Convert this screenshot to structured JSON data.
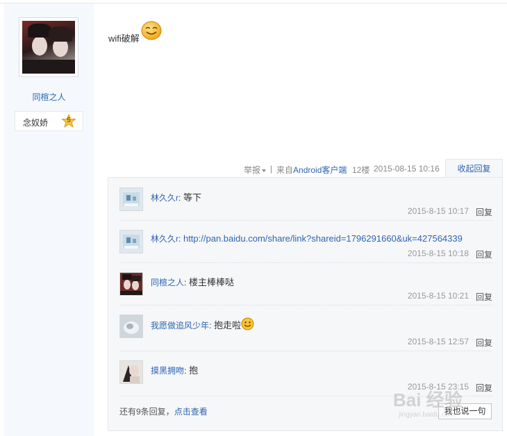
{
  "author": {
    "username": "同楦之人",
    "badge_name": "念奴娇",
    "badge_level": "5"
  },
  "post": {
    "text": "wifi破解",
    "emoticon": "smiley-face-icon"
  },
  "post_meta": {
    "report_label": "举报",
    "separator": "|",
    "from_prefix": "来自",
    "from_client": "Android客户端",
    "floor": "12楼",
    "date": "2015-08-15 10:16",
    "collapse_label": "收起回复"
  },
  "replies": [
    {
      "name": "林久久r",
      "content": "等下",
      "time": "2015-8-15 10:17",
      "reply_label": "回复"
    },
    {
      "name": "林久久r",
      "content": "http://pan.baidu.com/share/link?shareid=1796291660&uk=427564339",
      "time": "2015-8-15 10:18",
      "reply_label": "回复"
    },
    {
      "name": "同楦之人",
      "content": "楼主棒棒哒",
      "time": "2015-8-15 10:21",
      "reply_label": "回复"
    },
    {
      "name": "我愿做追风少年",
      "content": "抱走啦",
      "time": "2015-8-15 12:57",
      "reply_label": "回复"
    },
    {
      "name": "摸黑拥吻",
      "content": "抱",
      "time": "2015-8-15 23:15",
      "reply_label": "回复"
    }
  ],
  "more_replies": {
    "prefix": "还有9条回复，",
    "link": "点击查看"
  },
  "say_button": "我也说一句",
  "watermark": {
    "main": "Bai 经验",
    "sub": "jingyan.baidu.com"
  },
  "colors": {
    "link": "#2d64b3",
    "sidebar_bg": "#f5f8fc",
    "reply_panel_bg": "#f6f7f9"
  }
}
